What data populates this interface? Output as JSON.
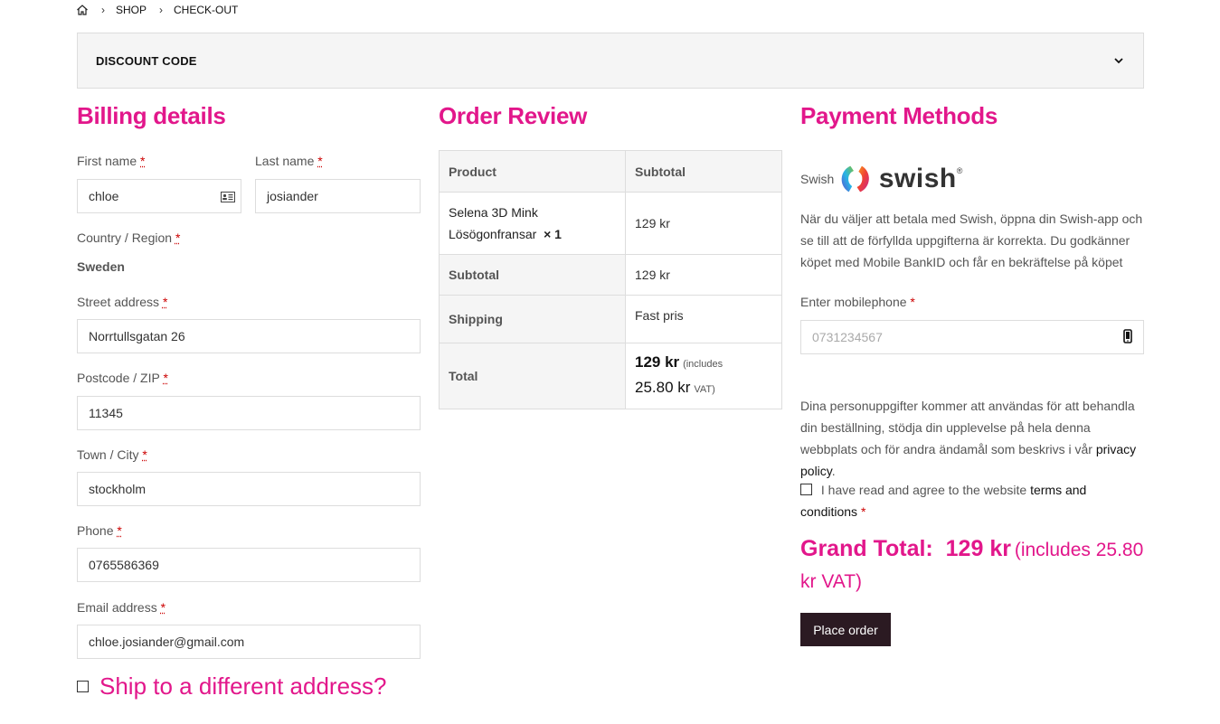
{
  "breadcrumb": {
    "items": [
      "SHOP",
      "CHECK-OUT"
    ]
  },
  "discount": {
    "label": "DISCOUNT CODE"
  },
  "billing": {
    "title": "Billing details",
    "first_name": {
      "label": "First name",
      "value": "chloe"
    },
    "last_name": {
      "label": "Last name",
      "value": "josiander"
    },
    "country": {
      "label": "Country / Region",
      "value": "Sweden"
    },
    "street": {
      "label": "Street address",
      "value": "Norrtullsgatan 26"
    },
    "postcode": {
      "label": "Postcode / ZIP",
      "value": "11345"
    },
    "town": {
      "label": "Town / City",
      "value": "stockholm"
    },
    "phone": {
      "label": "Phone",
      "value": "0765586369"
    },
    "email": {
      "label": "Email address",
      "value": "chloe.josiander@gmail.com"
    },
    "required_mark": "*",
    "ship_different": "Ship to a different address?"
  },
  "order": {
    "title": "Order Review",
    "col_product": "Product",
    "col_subtotal": "Subtotal",
    "item_name_1": "Selena 3D Mink",
    "item_name_2": "Lösögonfransar",
    "item_qty": "× 1",
    "item_price": "129 kr",
    "subtotal_label": "Subtotal",
    "subtotal_value": "129 kr",
    "shipping_label": "Shipping",
    "shipping_value": "Fast pris",
    "total_label": "Total",
    "total_value": "129 kr",
    "total_includes": "(includes",
    "total_vat_amount": "25.80 kr",
    "total_vat": "VAT)"
  },
  "payment": {
    "title": "Payment Methods",
    "method_label": "Swish",
    "brand": "swish",
    "description": "När du väljer att betala med Swish, öppna din Swish-app och se till att de förfyllda uppgifterna är korrekta. Du godkänner köpet med Mobile BankID och får en bekräftelse på köpet",
    "mobile_label": "Enter mobilephone",
    "mobile_placeholder": "0731234567",
    "privacy_text": "Dina personuppgifter kommer att användas för att behandla din beställning, stödja din upplevelse på hela denna webbplats och för andra ändamål som beskrivs i vår",
    "privacy_link": "privacy policy",
    "terms_text": "I have read and agree to the website",
    "terms_link": "terms and conditions",
    "grand_label": "Grand Total:",
    "grand_value": "129 kr",
    "grand_includes": "(includes 25.80 kr VAT)",
    "place_order": "Place order"
  },
  "colors": {
    "accent": "#e2178b",
    "button": "#2b1a22"
  }
}
